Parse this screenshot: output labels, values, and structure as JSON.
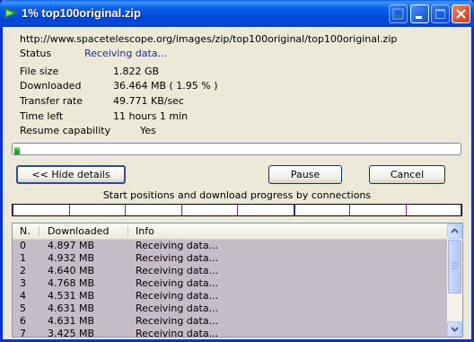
{
  "window": {
    "title": "1% top100original.zip"
  },
  "download": {
    "url": "http://www.spacetelescope.org/images/zip/top100original/top100original.zip",
    "status_label": "Status",
    "status_value": "Receiving data...",
    "file_size_label": "File size",
    "file_size_value": "1.822  GB",
    "downloaded_label": "Downloaded",
    "downloaded_value": "36.464  MB  ( 1.95 % )",
    "transfer_rate_label": "Transfer rate",
    "transfer_rate_value": "49.771  KB/sec",
    "time_left_label": "Time left",
    "time_left_value": "11 hours 1 min",
    "resume_label": "Resume capability",
    "resume_value": "Yes",
    "progress_percent": 1.95
  },
  "buttons": {
    "hide_details": "<< Hide details",
    "pause": "Pause",
    "cancel": "Cancel"
  },
  "connections": {
    "caption": "Start positions and download progress by connections",
    "count": 8
  },
  "list": {
    "headers": [
      "N.",
      "Downloaded",
      "Info"
    ],
    "rows": [
      {
        "n": "0",
        "downloaded": "4.897  MB",
        "info": "Receiving data..."
      },
      {
        "n": "1",
        "downloaded": "4.932  MB",
        "info": "Receiving data..."
      },
      {
        "n": "2",
        "downloaded": "4.640  MB",
        "info": "Receiving data..."
      },
      {
        "n": "3",
        "downloaded": "4.768  MB",
        "info": "Receiving data..."
      },
      {
        "n": "4",
        "downloaded": "4.531  MB",
        "info": "Receiving data..."
      },
      {
        "n": "5",
        "downloaded": "4.631  MB",
        "info": "Receiving data..."
      },
      {
        "n": "6",
        "downloaded": "4.631  MB",
        "info": "Receiving data..."
      },
      {
        "n": "7",
        "downloaded": "3.425  MB",
        "info": "Receiving data..."
      }
    ]
  },
  "icons": {
    "app": "idm-arrow-icon",
    "minimize_to_tray": "tray-icon",
    "minimize": "minimize-icon",
    "maximize": "maximize-icon",
    "close": "close-icon"
  },
  "colors": {
    "titlebar": "#0a5fe8",
    "progress": "#24b024",
    "row_highlight": "#c4bdc8",
    "status_text": "#1a2f9b"
  }
}
